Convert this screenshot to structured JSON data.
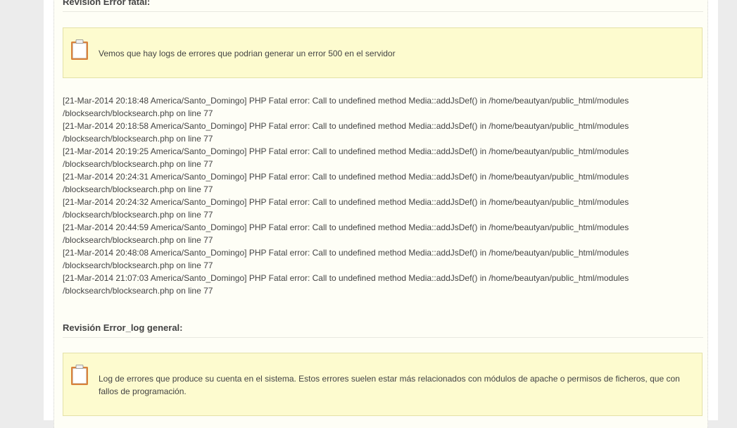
{
  "sections": {
    "fatal": {
      "heading": "Revisión Error fatal:",
      "notice": "Vemos que hay logs de errores que podrian generar un error 500 en el servidor",
      "logs": [
        {
          "line1": "[21-Mar-2014 20:18:48 America/Santo_Domingo] PHP Fatal error: Call to undefined method Media::addJsDef() in /home/beautyan/public_html/modules",
          "line2": "/blocksearch/blocksearch.php on line 77"
        },
        {
          "line1": "[21-Mar-2014 20:18:58 America/Santo_Domingo] PHP Fatal error: Call to undefined method Media::addJsDef() in /home/beautyan/public_html/modules",
          "line2": "/blocksearch/blocksearch.php on line 77"
        },
        {
          "line1": "[21-Mar-2014 20:19:25 America/Santo_Domingo] PHP Fatal error: Call to undefined method Media::addJsDef() in /home/beautyan/public_html/modules",
          "line2": "/blocksearch/blocksearch.php on line 77"
        },
        {
          "line1": "[21-Mar-2014 20:24:31 America/Santo_Domingo] PHP Fatal error: Call to undefined method Media::addJsDef() in /home/beautyan/public_html/modules",
          "line2": "/blocksearch/blocksearch.php on line 77"
        },
        {
          "line1": "[21-Mar-2014 20:24:32 America/Santo_Domingo] PHP Fatal error: Call to undefined method Media::addJsDef() in /home/beautyan/public_html/modules",
          "line2": "/blocksearch/blocksearch.php on line 77"
        },
        {
          "line1": "[21-Mar-2014 20:44:59 America/Santo_Domingo] PHP Fatal error: Call to undefined method Media::addJsDef() in /home/beautyan/public_html/modules",
          "line2": "/blocksearch/blocksearch.php on line 77"
        },
        {
          "line1": "[21-Mar-2014 20:48:08 America/Santo_Domingo] PHP Fatal error: Call to undefined method Media::addJsDef() in /home/beautyan/public_html/modules",
          "line2": "/blocksearch/blocksearch.php on line 77"
        },
        {
          "line1": "[21-Mar-2014 21:07:03 America/Santo_Domingo] PHP Fatal error: Call to undefined method Media::addJsDef() in /home/beautyan/public_html/modules",
          "line2": "/blocksearch/blocksearch.php on line 77"
        }
      ]
    },
    "general": {
      "heading": "Revisión Error_log general:",
      "notice": "Log de errores que produce su cuenta en el sistema. Estos errores suelen estar más relacionados con módulos de apache o permisos de ficheros, que con fallos de programación."
    }
  },
  "colors": {
    "notice_bg": "#fdfbcf",
    "notice_border": "#e4e1a8",
    "content_bg": "#fefef6",
    "clipboard": "#d9823b"
  },
  "icons": {
    "notice": "clipboard-icon"
  }
}
